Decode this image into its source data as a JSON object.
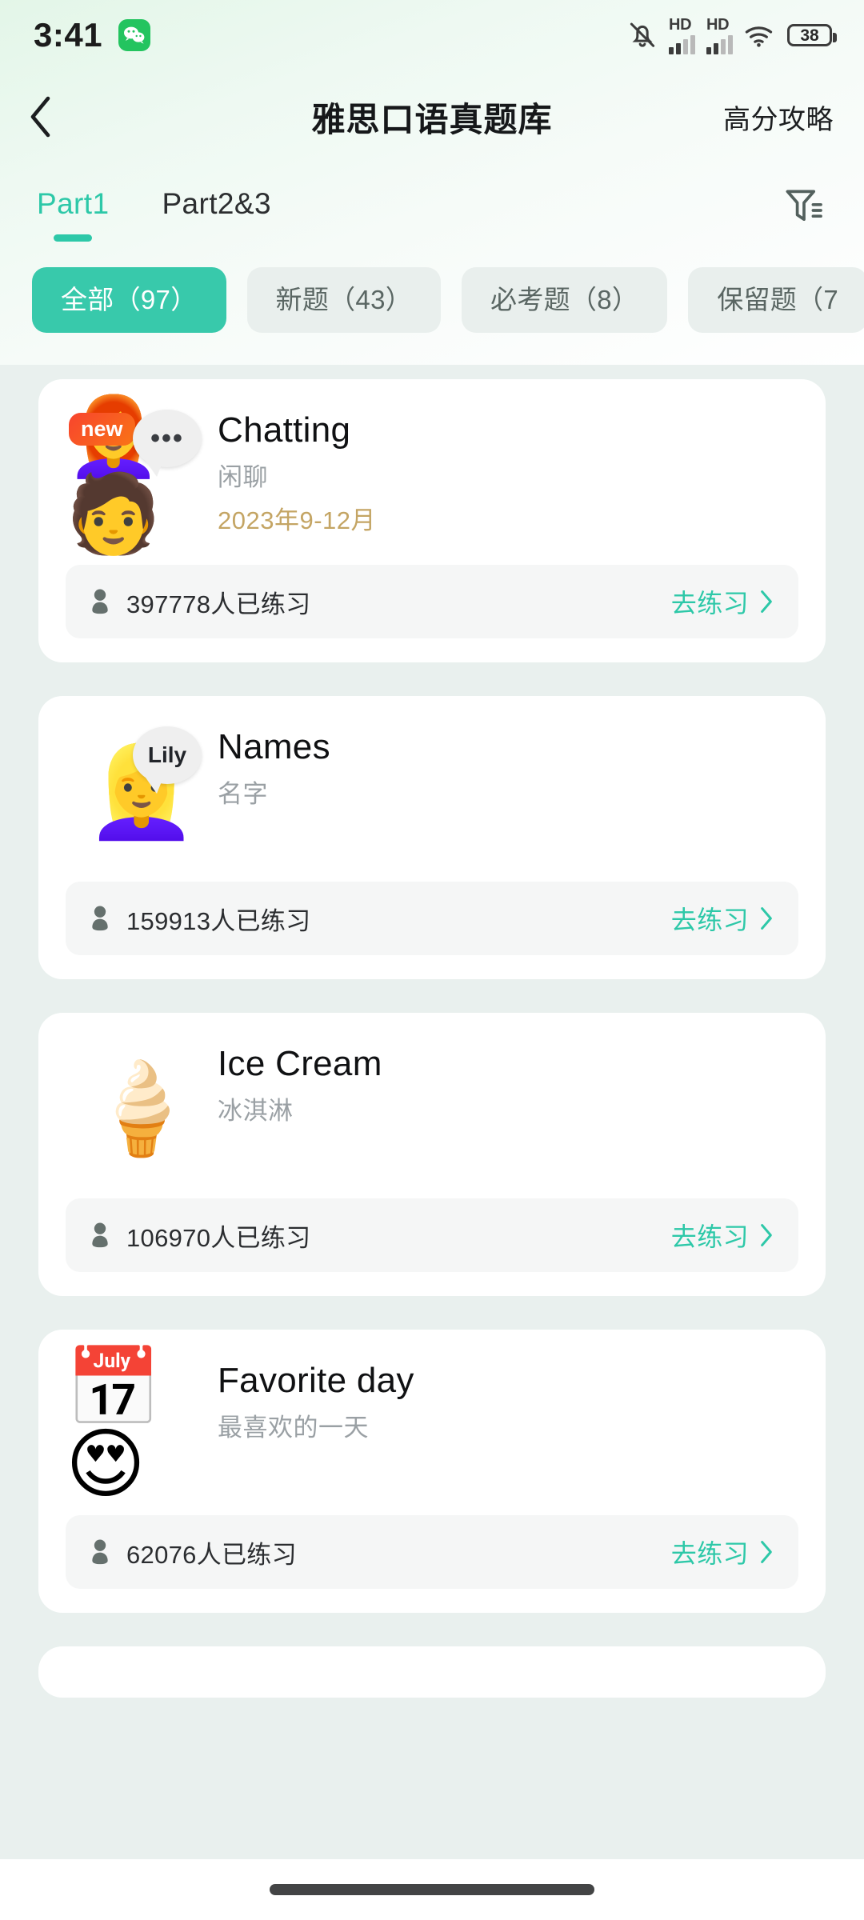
{
  "status_bar": {
    "time": "3:41",
    "wechat_icon": "wechat-icon",
    "mute_icon": "bell-muted-icon",
    "signal_1_label": "HD",
    "signal_2_label": "HD",
    "wifi_icon": "wifi-icon",
    "battery_level": "38"
  },
  "header": {
    "back_icon": "chevron-left-icon",
    "title": "雅思口语真题库",
    "action_label": "高分攻略"
  },
  "tabs": {
    "items": [
      {
        "label": "Part1",
        "active": true
      },
      {
        "label": "Part2&3",
        "active": false
      }
    ],
    "filter_icon": "filter-funnel-icon"
  },
  "filter_chips": [
    {
      "label": "全部（97）",
      "active": true
    },
    {
      "label": "新题（43）",
      "active": false
    },
    {
      "label": "必考题（8）",
      "active": false
    },
    {
      "label": "保留题（7",
      "active": false
    }
  ],
  "colors": {
    "accent_teal": "#2dc8a8",
    "chip_active": "#38c9ab",
    "badge_gradient_start": "#f8442e",
    "badge_gradient_end": "#f97416",
    "date_gold": "#c4a564",
    "content_bg": "#e9f0ee"
  },
  "cards": [
    {
      "emoji": "👩‍🦰🧑",
      "badge": "new",
      "bubble": "•••",
      "title": "Chatting",
      "subtitle": "闲聊",
      "date": "2023年9-12月",
      "practice_count": "397778人已练习",
      "action_label": "去练习",
      "person_icon": "person-icon",
      "chevron_icon": "chevron-right-icon"
    },
    {
      "emoji": "👱‍♀️",
      "badge": "",
      "bubble": "Lily",
      "title": "Names",
      "subtitle": "名字",
      "date": "",
      "practice_count": "159913人已练习",
      "action_label": "去练习",
      "person_icon": "person-icon",
      "chevron_icon": "chevron-right-icon"
    },
    {
      "emoji": "🍦",
      "badge": "",
      "bubble": "",
      "title": "Ice Cream",
      "subtitle": "冰淇淋",
      "date": "",
      "practice_count": "106970人已练习",
      "action_label": "去练习",
      "person_icon": "person-icon",
      "chevron_icon": "chevron-right-icon"
    },
    {
      "emoji": "📅😍",
      "badge": "",
      "bubble": "",
      "title": "Favorite day",
      "subtitle": "最喜欢的一天",
      "date": "",
      "practice_count": "62076人已练习",
      "action_label": "去练习",
      "person_icon": "person-icon",
      "chevron_icon": "chevron-right-icon"
    }
  ],
  "nav": {
    "home_indicator": "home-indicator"
  }
}
